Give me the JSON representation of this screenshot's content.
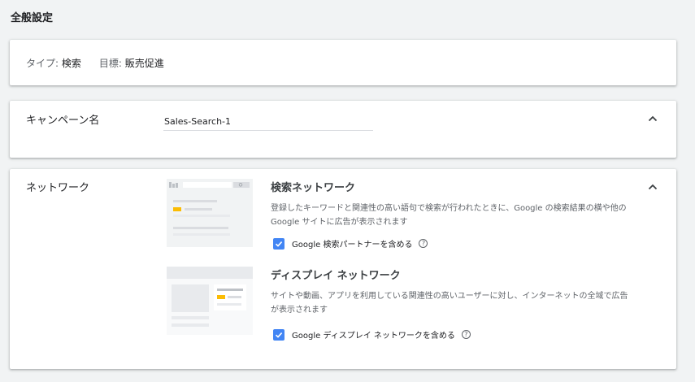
{
  "page_title": "全般設定",
  "summary": {
    "type_label": "タイプ:",
    "type_value": "検索",
    "goal_label": "目標:",
    "goal_value": "販売促進"
  },
  "campaign_name": {
    "label": "キャンペーン名",
    "value": "Sales-Search-1"
  },
  "network": {
    "label": "ネットワーク",
    "search": {
      "title": "検索ネットワーク",
      "description": "登録したキーワードと関連性の高い語句で検索が行われたときに、Google の検索結果の横や他の Google サイトに広告が表示されます",
      "checkbox_label": "Google 検索パートナーを含める",
      "checked": true
    },
    "display": {
      "title": "ディスプレイ ネットワーク",
      "description": "サイトや動画、アプリを利用している関連性の高いユーザーに対し、インターネットの全域で広告が表示されます",
      "checkbox_label": "Google ディスプレイ ネットワークを含める",
      "checked": true
    }
  },
  "colors": {
    "accent": "#4285f4",
    "highlight": "#fbbc04",
    "background": "#f1f3f4"
  },
  "icons": {
    "collapse": "chevron-up-icon",
    "help": "help-circle-icon",
    "check": "check-icon"
  }
}
